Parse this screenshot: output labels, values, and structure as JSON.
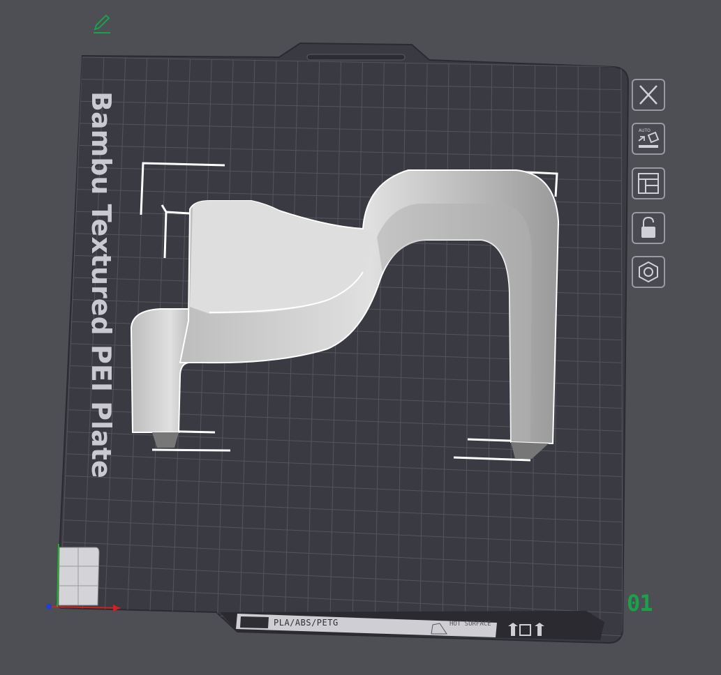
{
  "plate": {
    "name": "Bambu Textured PEI Plate",
    "number": "01",
    "bottom_label": "PLA/ABS/PETG",
    "warning": "HOT SURFACE"
  },
  "toolbar": {
    "edit_icon": "pencil-icon",
    "buttons": [
      {
        "name": "close-plate-button",
        "icon": "close-icon"
      },
      {
        "name": "auto-orient-button",
        "icon": "auto-orient-icon",
        "badge": "AUTO"
      },
      {
        "name": "arrange-button",
        "icon": "arrange-layout-icon"
      },
      {
        "name": "lock-button",
        "icon": "unlock-icon"
      },
      {
        "name": "plate-settings-button",
        "icon": "hexagon-nut-icon"
      }
    ]
  },
  "colors": {
    "background": "#4e4e55",
    "plate": "#3a3a42",
    "grid": "#55555e",
    "model": "#d6d6d6",
    "accent_green": "#1aa14a",
    "axis_x": "#d42020",
    "axis_y": "#20b030",
    "axis_z": "#2040d0"
  }
}
